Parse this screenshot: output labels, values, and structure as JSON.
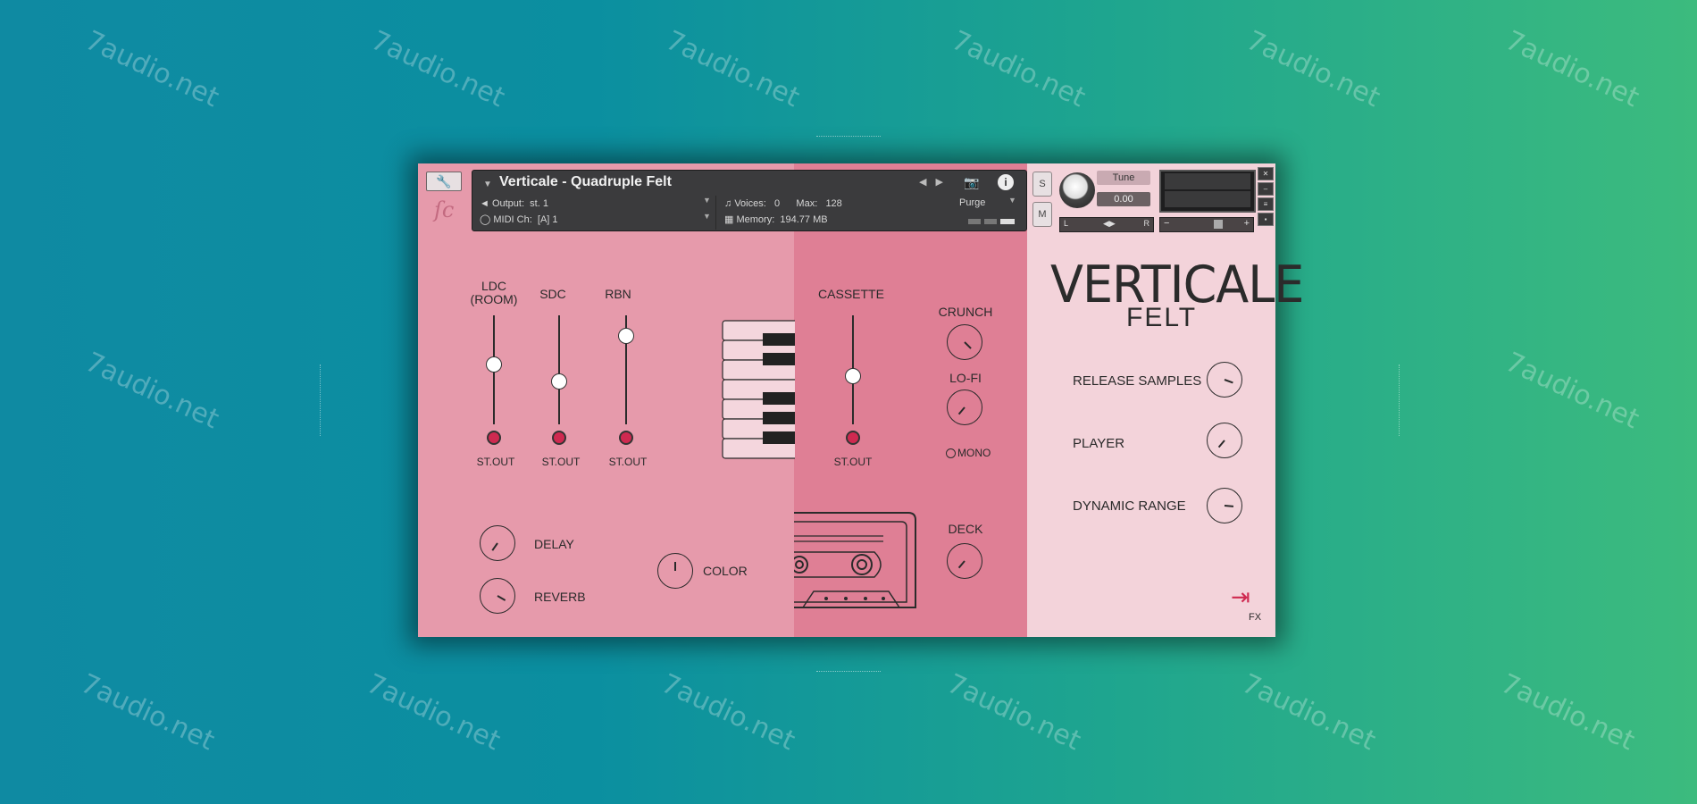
{
  "watermark": "7audio.net",
  "header": {
    "title": "Verticale - Quadruple Felt",
    "output_label": "Output:",
    "output_value": "st. 1",
    "midi_label": "MIDI Ch:",
    "midi_value": "[A]  1",
    "voices_label": "Voices:",
    "voices_value": "0",
    "max_label": "Max:",
    "max_value": "128",
    "memory_label": "Memory:",
    "memory_value": "194.77 MB",
    "purge_label": "Purge",
    "solo_label": "S",
    "mute_label": "M",
    "tune_label": "Tune",
    "tune_value": "0.00",
    "pan_left": "L",
    "pan_right": "R",
    "vol_minus": "−",
    "vol_plus": "+"
  },
  "mic_faders": [
    {
      "label": "LDC\n(ROOM)",
      "out": "ST.OUT",
      "level": 0.56
    },
    {
      "label": "SDC",
      "out": "ST.OUT",
      "level": 0.4
    },
    {
      "label": "RBN",
      "out": "ST.OUT",
      "level": 0.82
    }
  ],
  "cassette_fader": {
    "label": "CASSETTE",
    "out": "ST.OUT",
    "level": 0.45
  },
  "knobs_left": {
    "delay": "DELAY",
    "reverb": "REVERB",
    "color": "COLOR"
  },
  "knobs_mid": {
    "crunch": "CRUNCH",
    "lofi": "LO-FI",
    "mono": "MONO",
    "deck": "DECK"
  },
  "brand": {
    "name": "VERTICALE",
    "sub": "FELT"
  },
  "right_controls": {
    "release": "RELEASE SAMPLES",
    "player": "PLAYER",
    "dynamic": "DYNAMIC RANGE"
  },
  "fx_label": "FX",
  "colors": {
    "left_panel": "#e69aab",
    "mid_panel": "#df7f95",
    "right_panel": "#f3d3da",
    "accent": "#cf2950"
  }
}
